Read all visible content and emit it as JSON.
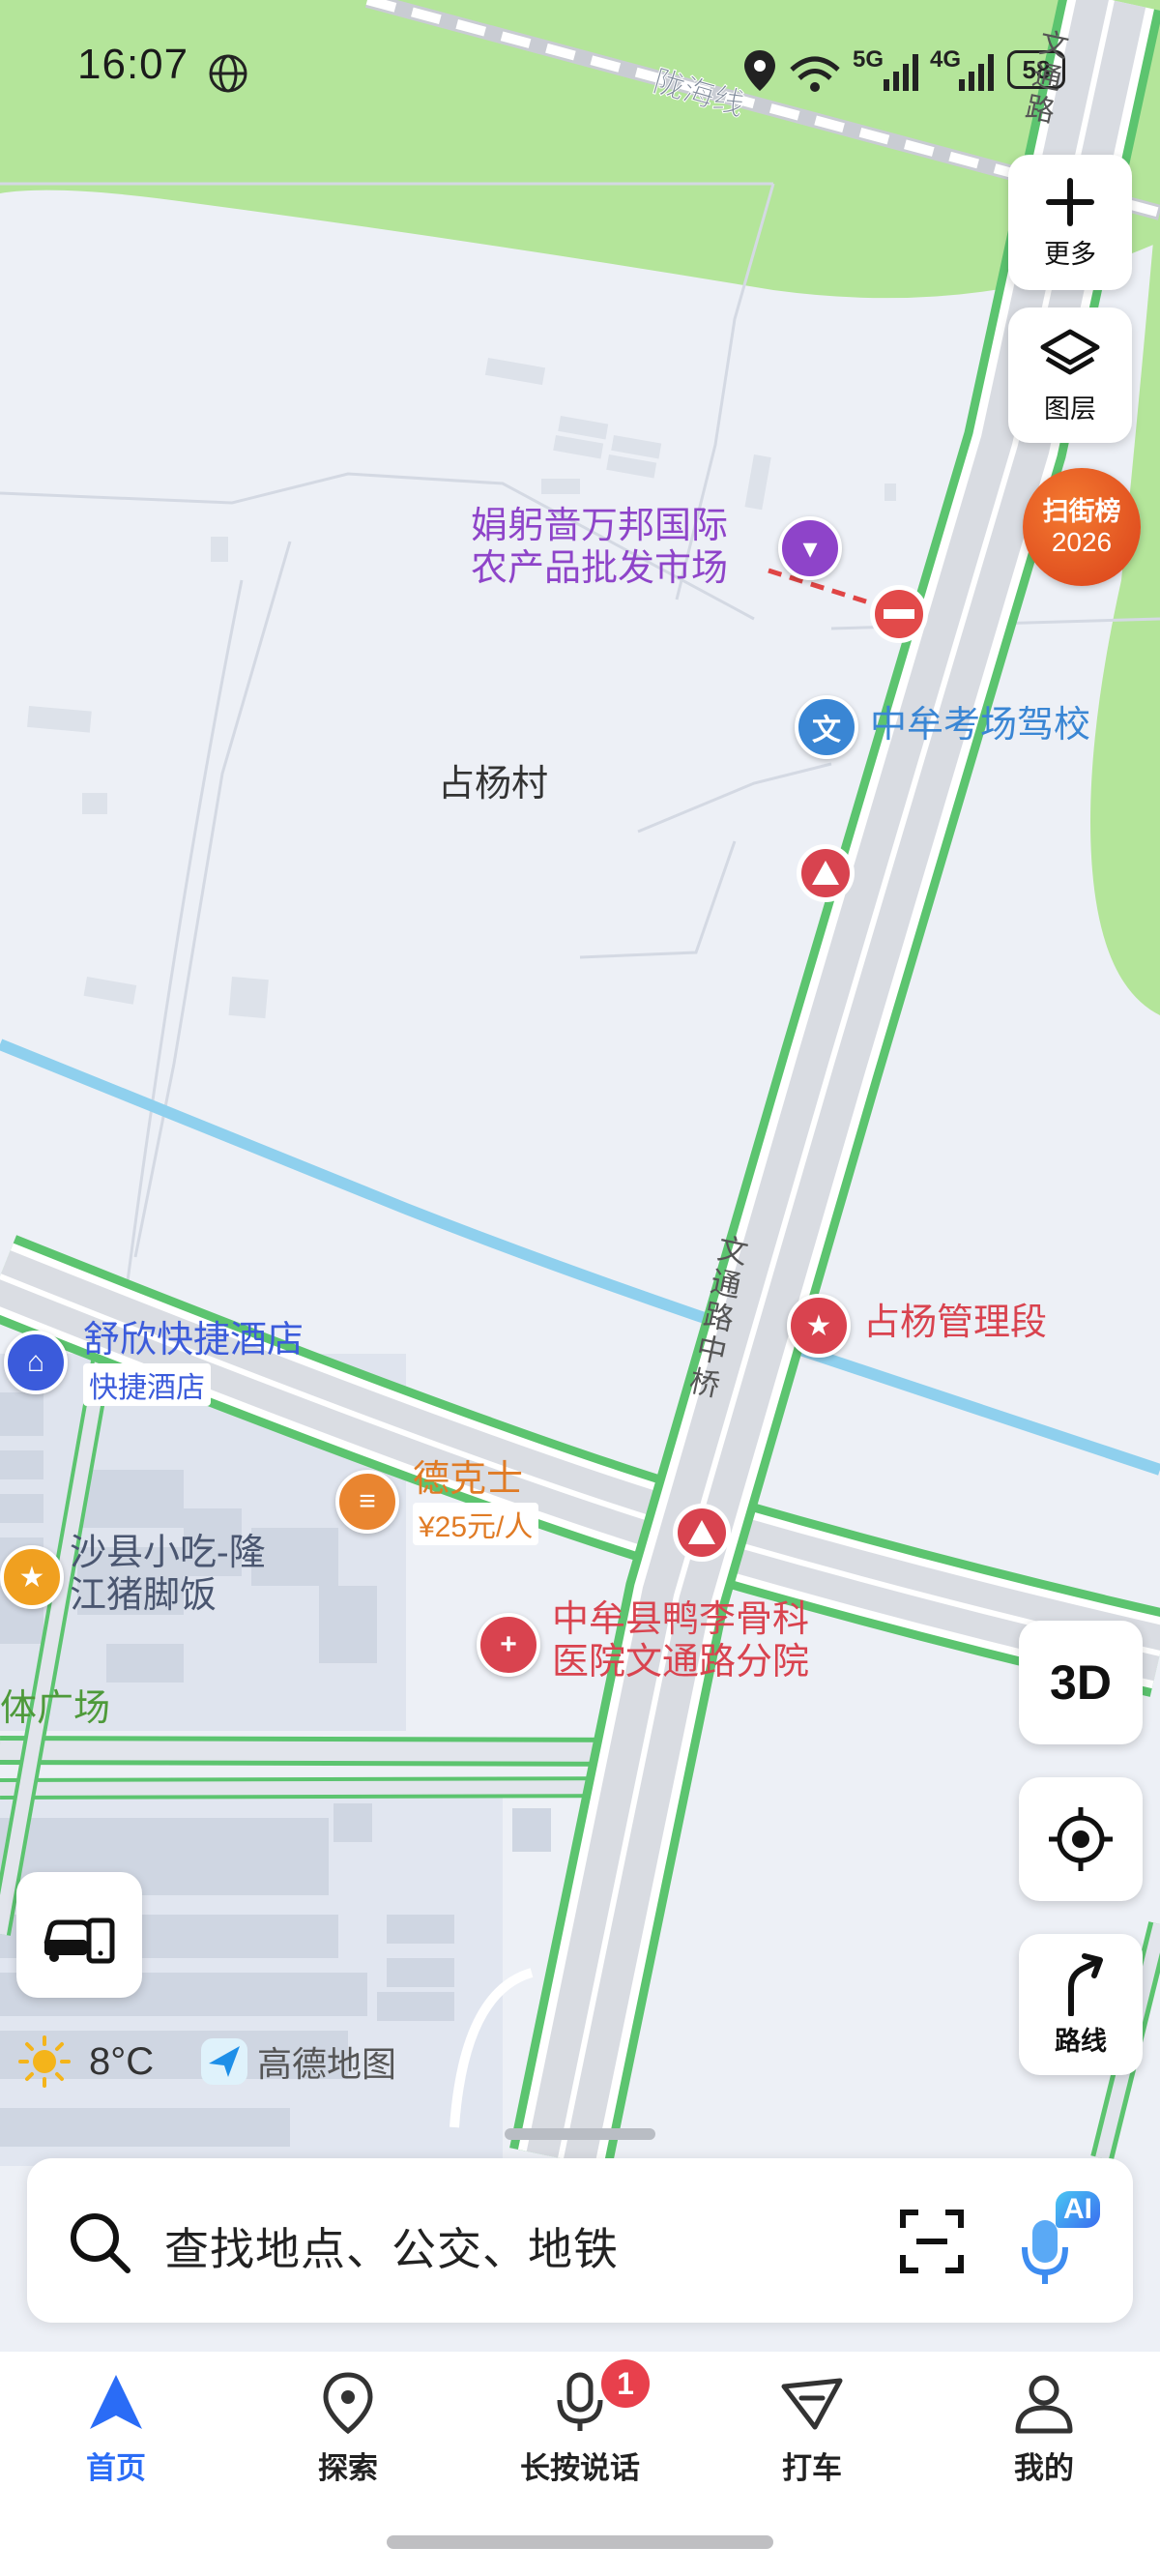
{
  "status_bar": {
    "time": "16:07",
    "network_5g": "5G",
    "network_4g": "4G",
    "battery": "58",
    "icons": [
      "globe-icon",
      "location-icon",
      "wifi-icon",
      "signal-icon",
      "battery-icon"
    ]
  },
  "map": {
    "rail_label": "陇海线",
    "road_top_label": "文通路",
    "road_main_label": "文通路中桥",
    "village_label": "占杨村",
    "partial_label": "体广场",
    "pois": [
      {
        "id": "market",
        "name_line1": "娟躬啬万邦国际",
        "name_line2": "农产品批发市场",
        "icon": "shopping-basket-icon",
        "color": "#8e44c9"
      },
      {
        "id": "driving-school",
        "name": "中牟考场驾校",
        "icon": "education-icon",
        "color": "#3a86d4"
      },
      {
        "id": "management",
        "name": "占杨管理段",
        "icon": "star-icon",
        "color": "#d9434f"
      },
      {
        "id": "hotel",
        "name": "舒欣快捷酒店",
        "sub": "快捷酒店",
        "icon": "bed-icon",
        "color": "#3b5bdb"
      },
      {
        "id": "dicos",
        "name": "德克士",
        "sub": "¥25元/人",
        "icon": "burger-icon",
        "color": "#e98530"
      },
      {
        "id": "snack",
        "name_line1": "沙县小吃-隆",
        "name_line2": "江猪脚饭",
        "icon": "star-food-icon",
        "color": "#f0a020"
      },
      {
        "id": "hospital",
        "name_line1": "中牟县鸭李骨科",
        "name_line2": "医院文通路分院",
        "icon": "medical-cross-icon",
        "color": "#d9434f"
      }
    ]
  },
  "controls": {
    "more_label": "更多",
    "layers_label": "图层",
    "scan_badge_line1": "扫街榜",
    "scan_badge_line2": "2026",
    "three_d_label": "3D",
    "route_label": "路线"
  },
  "info": {
    "weather": "8°C",
    "brand": "高德地图"
  },
  "search": {
    "placeholder": "查找地点、公交、地铁",
    "ai_label": "AI"
  },
  "tabs": [
    {
      "label": "首页",
      "icon": "navigation-arrow-icon",
      "active": true
    },
    {
      "label": "探索",
      "icon": "location-pin-icon",
      "active": false
    },
    {
      "label": "长按说话",
      "icon": "microphone-icon",
      "active": false,
      "badge": "1"
    },
    {
      "label": "打车",
      "icon": "taxi-icon",
      "active": false
    },
    {
      "label": "我的",
      "icon": "user-icon",
      "active": false
    }
  ],
  "colors": {
    "accent": "#2a6cf6",
    "road_green": "#5cc46f",
    "water": "#8fd0ee",
    "park": "#b4e59a",
    "scan_badge": "#e8571f",
    "badge_red": "#e8404c"
  }
}
